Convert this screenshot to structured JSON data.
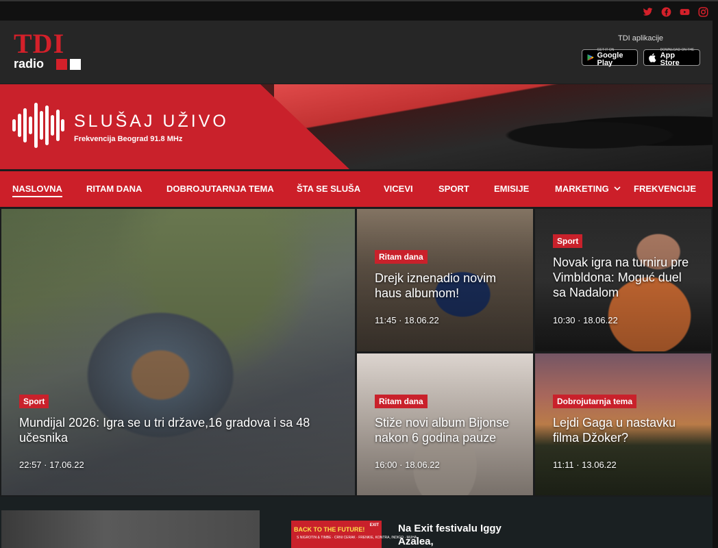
{
  "social": {
    "icons": [
      "twitter-icon",
      "facebook-icon",
      "youtube-icon",
      "instagram-icon"
    ]
  },
  "logo": {
    "text": "TDI",
    "sub": "radio"
  },
  "apps": {
    "label": "TDI aplikacije",
    "google_small": "GET IT ON",
    "google_big": "Google Play",
    "apple_small": "Download on the",
    "apple_big": "App Store"
  },
  "live": {
    "title": "SLUŠAJ UŽIVO",
    "subtitle": "Frekvencija Beograd 91.8 MHz"
  },
  "nav": {
    "items": [
      "NASLOVNA",
      "RITAM DANA",
      "DOBROJUTARNJA TEMA",
      "ŠTA SE SLUŠA",
      "VICEVI",
      "SPORT",
      "EMISIJE",
      "MARKETING",
      "FREKVENCIJE"
    ],
    "active": "NASLOVNA"
  },
  "articles": [
    {
      "tag": "Sport",
      "title": "Mundijal 2026: Igra se u tri države,16 gradova i sa 48 učesnika",
      "time": "22:57 · 17.06.22"
    },
    {
      "tag": "Ritam dana",
      "title": "Drejk iznenadio novim haus albumom!",
      "time": "11:45 · 18.06.22"
    },
    {
      "tag": "Sport",
      "title": "Novak igra na turniru pre Vimbldona: Moguć duel sa Nadalom",
      "time": "10:30 · 18.06.22"
    },
    {
      "tag": "Ritam dana",
      "title": "Stiže novi album Bijonse nakon 6 godina pauze",
      "time": "16:00 · 18.06.22"
    },
    {
      "tag": "Dobrojutarnja tema",
      "title": "Lejdi Gaga u nastavku filma Džoker?",
      "time": "11:11 · 13.06.22"
    }
  ],
  "bottom": {
    "thumb_text": "BACK TO THE FUTURE!",
    "thumb_small": "S NIGROTIN & TIMBE · CRNI CERAK · FRENKIE, KONTRA, INDIGO · MUHA",
    "thumb_exit": "EXIT",
    "side_title": "Na Exit festivalu Iggy Azalea,"
  },
  "colors": {
    "accent": "#c9212b",
    "bg": "#1a1c1d",
    "header": "#262626"
  }
}
